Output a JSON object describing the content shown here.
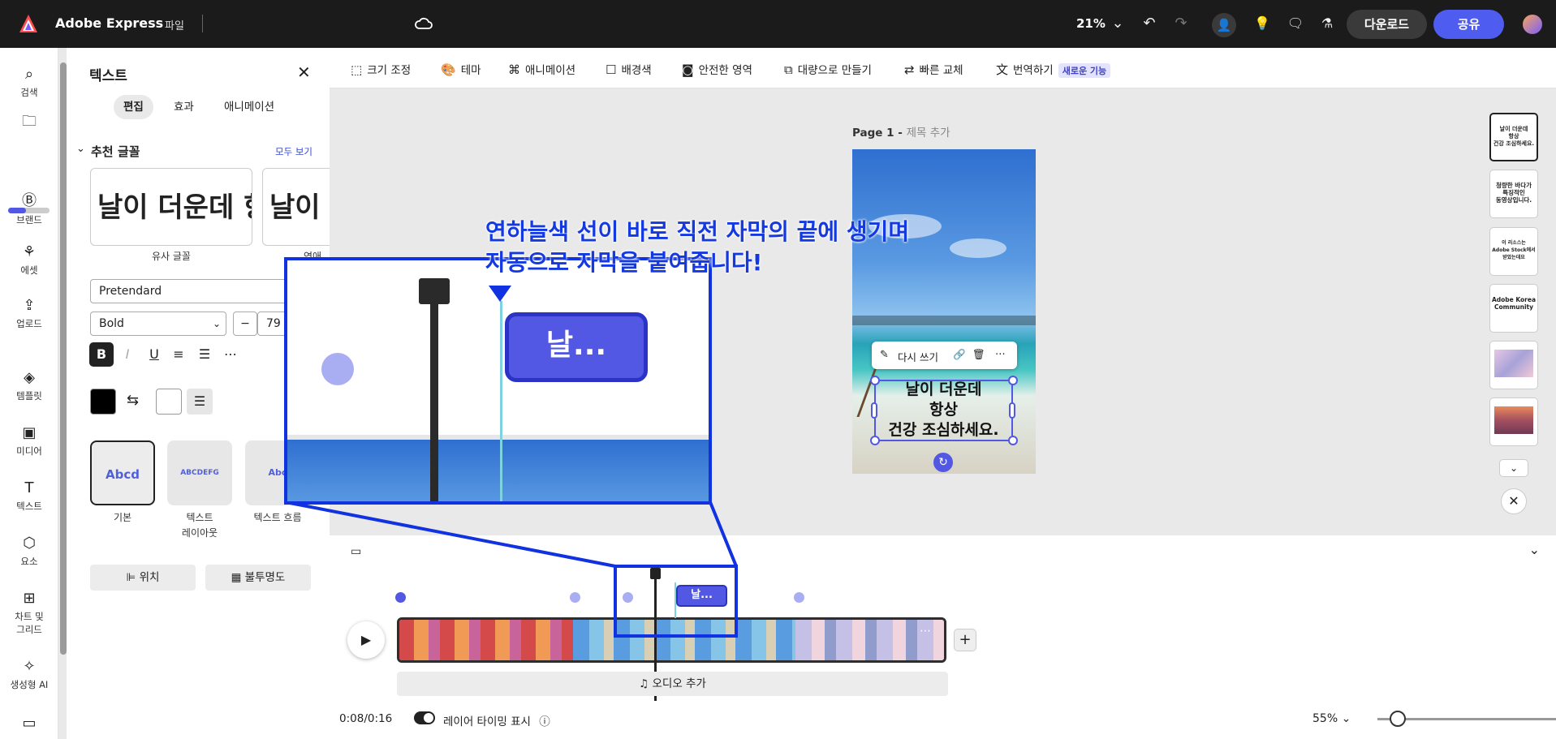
{
  "app": {
    "title": "Adobe Express",
    "file_menu": "파일",
    "zoom": "21%",
    "download": "다운로드",
    "share": "공유"
  },
  "rail": [
    {
      "label": "검색",
      "icon": "search-icon"
    },
    {
      "label": "",
      "icon": "folder-icon"
    },
    {
      "label": "브랜드",
      "icon": "brand-icon"
    },
    {
      "label": "에셋",
      "icon": "assets-icon"
    },
    {
      "label": "업로드",
      "icon": "upload-icon"
    },
    {
      "label": "템플릿",
      "icon": "template-icon"
    },
    {
      "label": "미디어",
      "icon": "media-icon"
    },
    {
      "label": "텍스트",
      "icon": "text-icon"
    },
    {
      "label": "요소",
      "icon": "elements-icon"
    },
    {
      "label": "차트 및\n그리드",
      "icon": "chart-grid-icon"
    },
    {
      "label": "생성형 AI",
      "icon": "generative-ai-icon"
    }
  ],
  "panel": {
    "title": "텍스트",
    "tabs": [
      "편집",
      "효과",
      "애니메이션"
    ],
    "recommended_fonts": "추천 글꼴",
    "see_all": "모두 보기",
    "font_samples": [
      "날이 더운데 항",
      "날이 더"
    ],
    "font_captions": [
      "유사 글꼴",
      "연애 글"
    ],
    "font_family": "Pretendard",
    "font_weight": "Bold",
    "font_size": "79",
    "styles": [
      {
        "sample": "Abcd",
        "label": "기본"
      },
      {
        "sample": "ABCDEFG",
        "label": "텍스트\n레이아웃"
      },
      {
        "sample": "Abc",
        "label": "텍스트 흐름"
      }
    ],
    "position_btn": "위치",
    "opacity_btn": "불투명도"
  },
  "toolbar": {
    "resize": "크기 조정",
    "theme": "테마",
    "animation": "애니메이션",
    "background": "배경색",
    "safe_area": "안전한 영역",
    "bulk_create": "대량으로 만들기",
    "quick_swap": "빠른 교체",
    "translate": "번역하기",
    "new_feature": "새로운 기능"
  },
  "canvas": {
    "page_label": "Page 1 - ",
    "page_title_placeholder": "제목 추가",
    "caption_lines": [
      "날이 더운데",
      "항상",
      "건강 조심하세요."
    ],
    "rewrite": "다시 쓰기"
  },
  "thumbnails": [
    "날이 더운데\n항상\n건강 조심하세요.",
    "청량한 바다가\n특징적인\n동영상입니다.",
    "이 리소스는\nAdobe Stock에서\n받았는데요",
    "Adobe Korea\nCommunity",
    "",
    ""
  ],
  "annotation": {
    "line1": "연하늘색 선이 바로 직전 자막의 끝에 생기며",
    "line2": "자동으로 자막을 붙여줍니다!",
    "zoom_chip": "날...",
    "clip_chip": "날..."
  },
  "timeline": {
    "audio_add": "오디오 추가",
    "time": "0:08/0:16",
    "layer_timing": "레이어 타이밍 표시",
    "zoom": "55%"
  },
  "colors": {
    "accent": "#5258e4",
    "annotation": "#1032e0",
    "topbar": "#1b1b1b"
  }
}
